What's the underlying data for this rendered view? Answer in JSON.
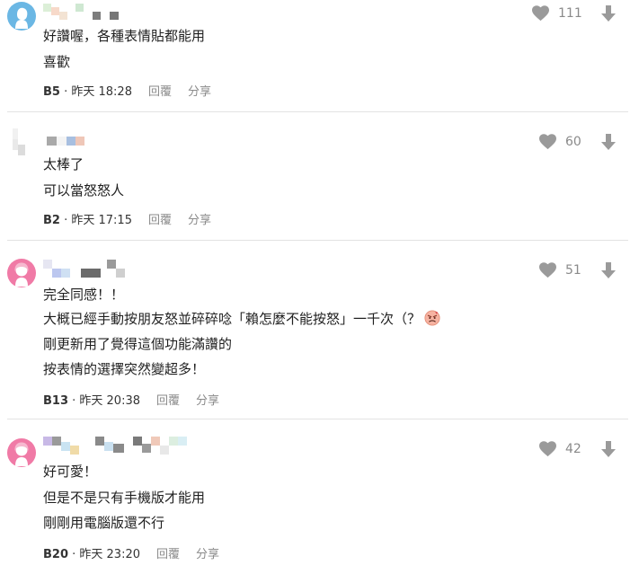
{
  "comments": [
    {
      "lines": [
        "好讚喔，各種表情貼都能用",
        "喜歡"
      ],
      "floor": "B5",
      "time": "昨天 18:28",
      "reply": "回覆",
      "share": "分享",
      "likes": "111"
    },
    {
      "lines": [
        "太棒了",
        "可以當怒怒人"
      ],
      "floor": "B2",
      "time": "昨天 17:15",
      "reply": "回覆",
      "share": "分享",
      "likes": "60"
    },
    {
      "lines": [
        "完全同感！！",
        "大概已經手動按朋友怒並碎碎唸「賴怎麼不能按怒」一千次（？",
        "剛更新用了覺得這個功能滿讚的",
        "按表情的選擇突然變超多！"
      ],
      "floor": "B13",
      "time": "昨天 20:38",
      "reply": "回覆",
      "share": "分享",
      "likes": "51",
      "emoji": "angry-face-emoji"
    },
    {
      "lines": [
        "好可愛！",
        "但是不是只有手機版才能用",
        "剛剛用電腦版還不行"
      ],
      "floor": "B20",
      "time": "昨天 23:20",
      "reply": "回覆",
      "share": "分享",
      "likes": "42"
    }
  ],
  "meta_separator": " · ",
  "colors": {
    "avatar_blue": "#6bb7e4",
    "avatar_pink": "#f07aa6",
    "icon_gray": "#9a9a9a",
    "text_gray": "#8a8a8a",
    "divider": "#e3e3e3"
  },
  "icons": [
    "heart-icon",
    "down-arrow-icon",
    "angry-face-emoji"
  ]
}
